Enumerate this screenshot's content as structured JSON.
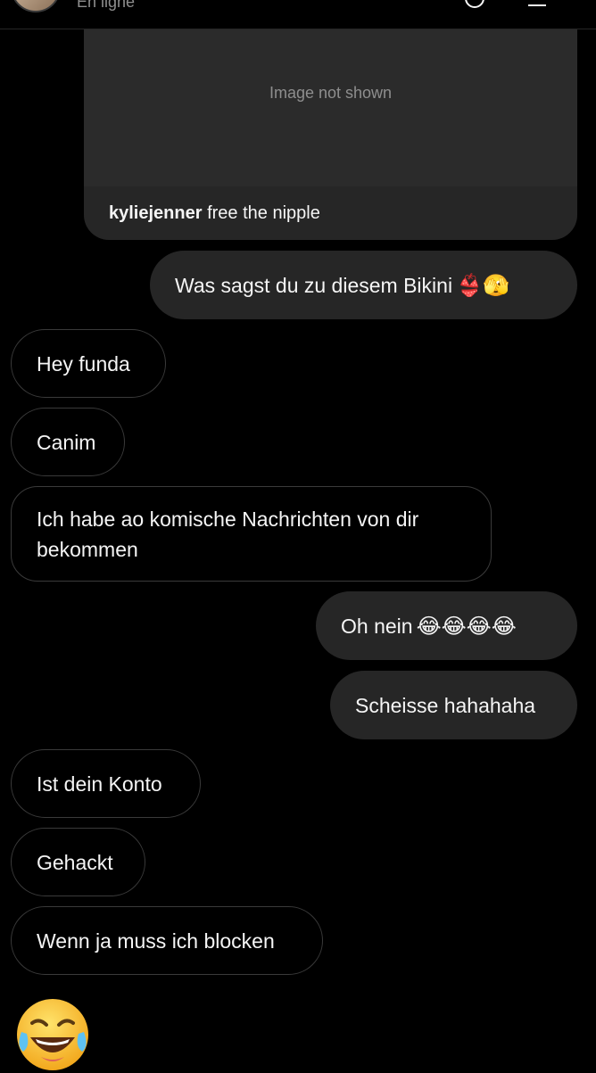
{
  "header": {
    "presence": "En ligne"
  },
  "post": {
    "image_label": "Image not shown",
    "username": "kyliejenner",
    "caption": "free the nipple"
  },
  "messages": [
    {
      "dir": "out",
      "text": "Was sagst du zu diesem Bikini",
      "emoji": "👙🫣"
    },
    {
      "dir": "in",
      "text": "Hey funda"
    },
    {
      "dir": "in",
      "text": "Canim"
    },
    {
      "dir": "in",
      "text": "Ich habe ao komische Nachrichten von dir bekommen"
    },
    {
      "dir": "out",
      "text": "Oh nein",
      "emoji": "😂😂😂😂"
    },
    {
      "dir": "out",
      "text": "Scheisse hahahaha"
    },
    {
      "dir": "in",
      "text": "Ist dein Konto"
    },
    {
      "dir": "in",
      "text": "Gehackt"
    },
    {
      "dir": "in",
      "text": "Wenn ja muss ich blocken"
    }
  ],
  "reaction_emoji": "laughing-tears-emoji",
  "colors": {
    "background": "#000000",
    "outgoing_bubble": "#262626",
    "incoming_border": "#3a3a3a",
    "text": "#f5f5f5",
    "secondary_text": "#8e8e8e"
  }
}
